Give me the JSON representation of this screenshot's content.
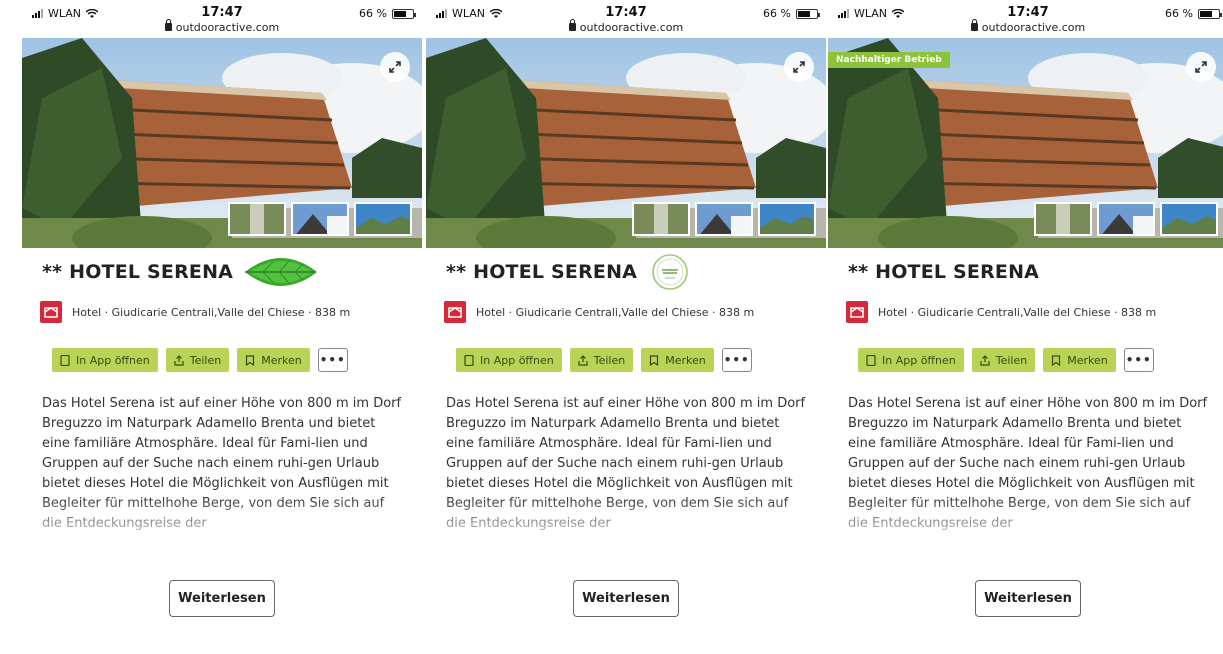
{
  "screens": [
    {
      "status": {
        "carrier": "WLAN",
        "time": "17:47",
        "battery": "66 %",
        "url": "outdooractive.com"
      },
      "badge": "",
      "title": "** HOTEL SERENA",
      "category": "Hotel · Giudicarie Centrali,Valle del Chiese · 838 m",
      "actions": {
        "open_app": "In App öffnen",
        "share": "Teilen",
        "save": "Merken",
        "more": "•••"
      },
      "description": "Das Hotel Serena ist auf einer Höhe von 800 m im Dorf Breguzzo im Naturpark Adamello Brenta und bietet eine familiäre Atmosphäre. Ideal für Fami-lien und Gruppen auf der Suche nach einem ruhi-gen Urlaub bietet dieses Hotel die Möglichkeit von Ausflügen mit Begleiter für mittelhohe Berge, von dem Sie sich auf die Entdeckungsreise der",
      "read_more": "Weiterlesen"
    },
    {
      "status": {
        "carrier": "WLAN",
        "time": "17:47",
        "battery": "66 %",
        "url": "outdooractive.com"
      },
      "badge": "",
      "title": "** HOTEL SERENA",
      "category": "Hotel · Giudicarie Centrali,Valle del Chiese · 838 m",
      "actions": {
        "open_app": "In App öffnen",
        "share": "Teilen",
        "save": "Merken",
        "more": "•••"
      },
      "description": "Das Hotel Serena ist auf einer Höhe von 800 m im Dorf Breguzzo im Naturpark Adamello Brenta und bietet eine familiäre Atmosphäre. Ideal für Fami-lien und Gruppen auf der Suche nach einem ruhi-gen Urlaub bietet dieses Hotel die Möglichkeit von Ausflügen mit Begleiter für mittelhohe Berge, von dem Sie sich auf die Entdeckungsreise der",
      "read_more": "Weiterlesen"
    },
    {
      "status": {
        "carrier": "WLAN",
        "time": "17:47",
        "battery": "66 %",
        "url": "outdooractive.com"
      },
      "badge": "Nachhaltiger Betrieb",
      "title": "** HOTEL SERENA",
      "category": "Hotel · Giudicarie Centrali,Valle del Chiese · 838 m",
      "actions": {
        "open_app": "In App öffnen",
        "share": "Teilen",
        "save": "Merken",
        "more": "•••"
      },
      "description": "Das Hotel Serena ist auf einer Höhe von 800 m im Dorf Breguzzo im Naturpark Adamello Brenta und bietet eine familiäre Atmosphäre. Ideal für Fami-lien und Gruppen auf der Suche nach einem ruhi-gen Urlaub bietet dieses Hotel die Möglichkeit von Ausflügen mit Begleiter für mittelhohe Berge, von dem Sie sich auf die Entdeckungsreise der",
      "read_more": "Weiterlesen"
    }
  ],
  "colors": {
    "action_green": "#b9d356",
    "badge_green": "#8dc33a",
    "category_red": "#d6283b"
  },
  "icons": {
    "screen0_title": "leaf-icon",
    "screen1_title": "good-travel-seal-icon"
  }
}
